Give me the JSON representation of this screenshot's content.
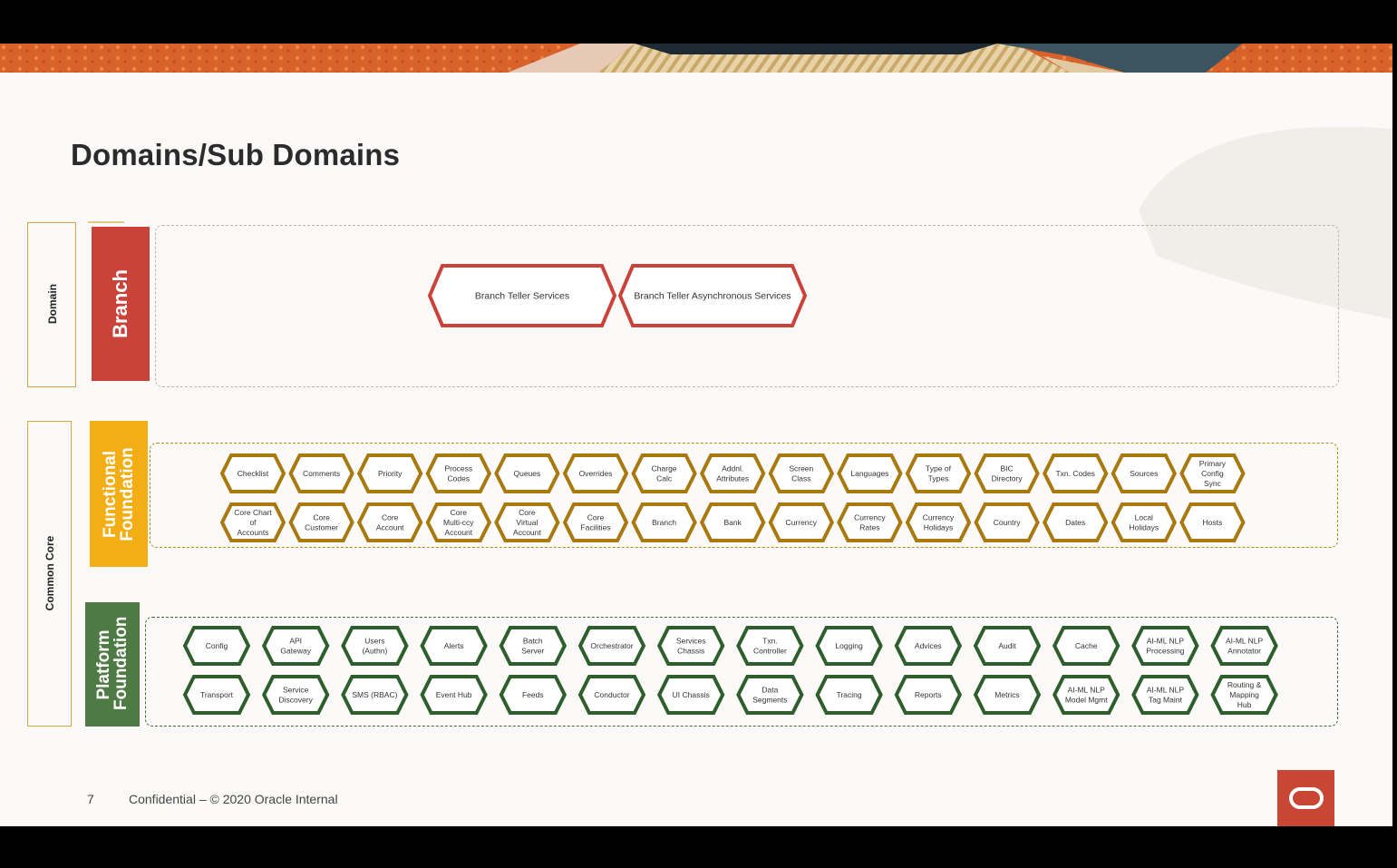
{
  "title": "Domains/Sub Domains",
  "labels": {
    "domain": "Domain",
    "common_core": "Common Core"
  },
  "groups": [
    {
      "key": "branch",
      "label": "Branch",
      "color": "#c9433a",
      "rows": [
        [
          "Branch Teller Services",
          "Branch Teller Asynchronous Services"
        ]
      ]
    },
    {
      "key": "functional",
      "label": "Functional Foundation",
      "color": "#f2ae14",
      "stroke": "#a8790f",
      "rows": [
        [
          "Checklist",
          "Comments",
          "Priority",
          "Process Codes",
          "Queues",
          "Overrides",
          "Charge Calc",
          "Addnl. Attributes",
          "Screen Class",
          "Languages",
          "Type of Types",
          "BIC Directory",
          "Txn. Codes",
          "Sources",
          "Primary Config Sync"
        ],
        [
          "Core Chart of Accounts",
          "Core Customer",
          "Core Account",
          "Core Multi-ccy Account",
          "Core Virtual Account",
          "Core Facilities",
          "Branch",
          "Bank",
          "Currency",
          "Currency Rates",
          "Currency Holidays",
          "Country",
          "Dates",
          "Local Holidays",
          "Hosts"
        ]
      ]
    },
    {
      "key": "platform",
      "label": "Platform Foundation",
      "color": "#4e7a44",
      "stroke": "#2f5e2d",
      "rows": [
        [
          "Config",
          "API Gateway",
          "Users (Authn)",
          "Alerts",
          "Batch Server",
          "Orchestrator",
          "Services Chassis",
          "Txn. Controller",
          "Logging",
          "Advices",
          "Audit",
          "Cache",
          "AI-ML NLP Processing",
          "AI-ML NLP Annotator"
        ],
        [
          "Transport",
          "Service Discovery",
          "SMS (RBAC)",
          "Event Hub",
          "Feeds",
          "Conductor",
          "UI Chassis",
          "Data Segments",
          "Tracing",
          "Reports",
          "Metrics",
          "AI-ML NLP Model Mgmt",
          "AI-ML NLP Tag Maint",
          "Routing & Mapping Hub"
        ]
      ]
    }
  ],
  "footer": {
    "page_number": "7",
    "text": "Confidential – © 2020 Oracle Internal"
  }
}
